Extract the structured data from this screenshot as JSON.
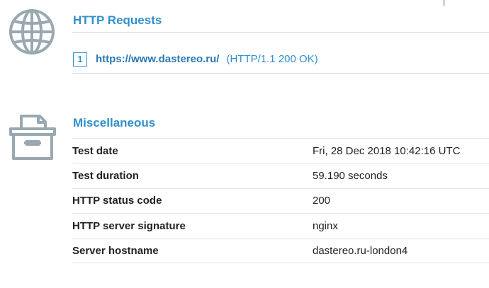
{
  "colors": {
    "accent": "#2f8fca",
    "link": "#2a79b4",
    "icon": "#9aa8b1",
    "text": "#222222"
  },
  "http_requests": {
    "title": "HTTP Requests",
    "icon": "globe-icon",
    "requests": [
      {
        "index": "1",
        "url": "https://www.dastereo.ru/",
        "status": "(HTTP/1.1 200 OK)"
      }
    ]
  },
  "miscellaneous": {
    "title": "Miscellaneous",
    "icon": "archive-box-icon",
    "rows": [
      {
        "label": "Test date",
        "value": "Fri, 28 Dec 2018 10:42:16 UTC"
      },
      {
        "label": "Test duration",
        "value": "59.190 seconds"
      },
      {
        "label": "HTTP status code",
        "value": "200"
      },
      {
        "label": "HTTP server signature",
        "value": "nginx"
      },
      {
        "label": "Server hostname",
        "value": "dastereo.ru-london4"
      }
    ]
  }
}
